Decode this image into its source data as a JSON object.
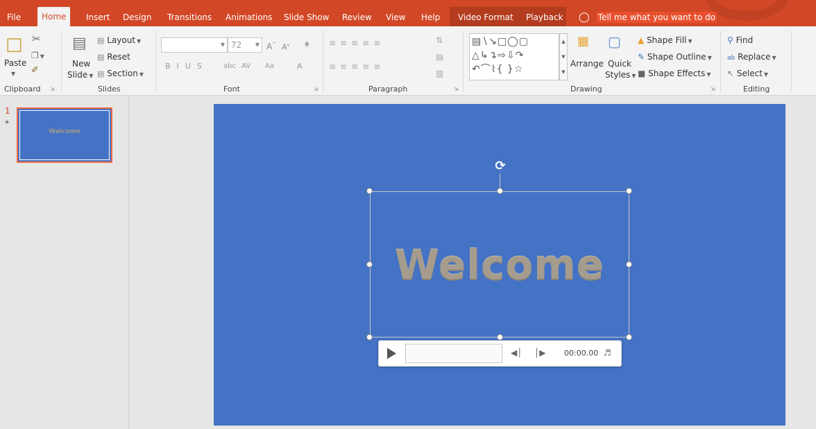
{
  "tabs": [
    {
      "label": "File",
      "active": false
    },
    {
      "label": "Home",
      "active": true
    },
    {
      "label": "Insert",
      "active": false
    },
    {
      "label": "Design",
      "active": false
    },
    {
      "label": "Transitions",
      "active": false
    },
    {
      "label": "Animations",
      "active": false
    },
    {
      "label": "Slide Show",
      "active": false
    },
    {
      "label": "Review",
      "active": false
    },
    {
      "label": "View",
      "active": false
    },
    {
      "label": "Help",
      "active": false
    },
    {
      "label": "Video Format",
      "active": false
    },
    {
      "label": "Playback",
      "active": false
    }
  ],
  "tell_me": "Tell me what you want to do",
  "ribbon": {
    "clipboard": {
      "label": "Clipboard",
      "paste": "Paste"
    },
    "slides": {
      "label": "Slides",
      "new_slide_line1": "New",
      "new_slide_line2": "Slide",
      "layout": "Layout",
      "reset": "Reset",
      "section": "Section"
    },
    "font": {
      "label": "Font",
      "font_name": "",
      "font_size": "72"
    },
    "paragraph": {
      "label": "Paragraph"
    },
    "drawing": {
      "label": "Drawing",
      "arrange": "Arrange",
      "quick_styles_line1": "Quick",
      "quick_styles_line2": "Styles",
      "shape_fill": "Shape Fill",
      "shape_outline": "Shape Outline",
      "shape_effects": "Shape Effects"
    },
    "editing": {
      "label": "Editing",
      "find": "Find",
      "replace": "Replace",
      "select": "Select"
    }
  },
  "thumbnail": {
    "number": "1",
    "star": "★",
    "text": "Welcome"
  },
  "slide": {
    "text": "Welcome",
    "bg_color": "#4472c4"
  },
  "media": {
    "time": "00:00.00"
  },
  "colors": {
    "accent": "#d24726",
    "slide_bg": "#4472c4",
    "selected_thumb_border": "#f06a43"
  }
}
